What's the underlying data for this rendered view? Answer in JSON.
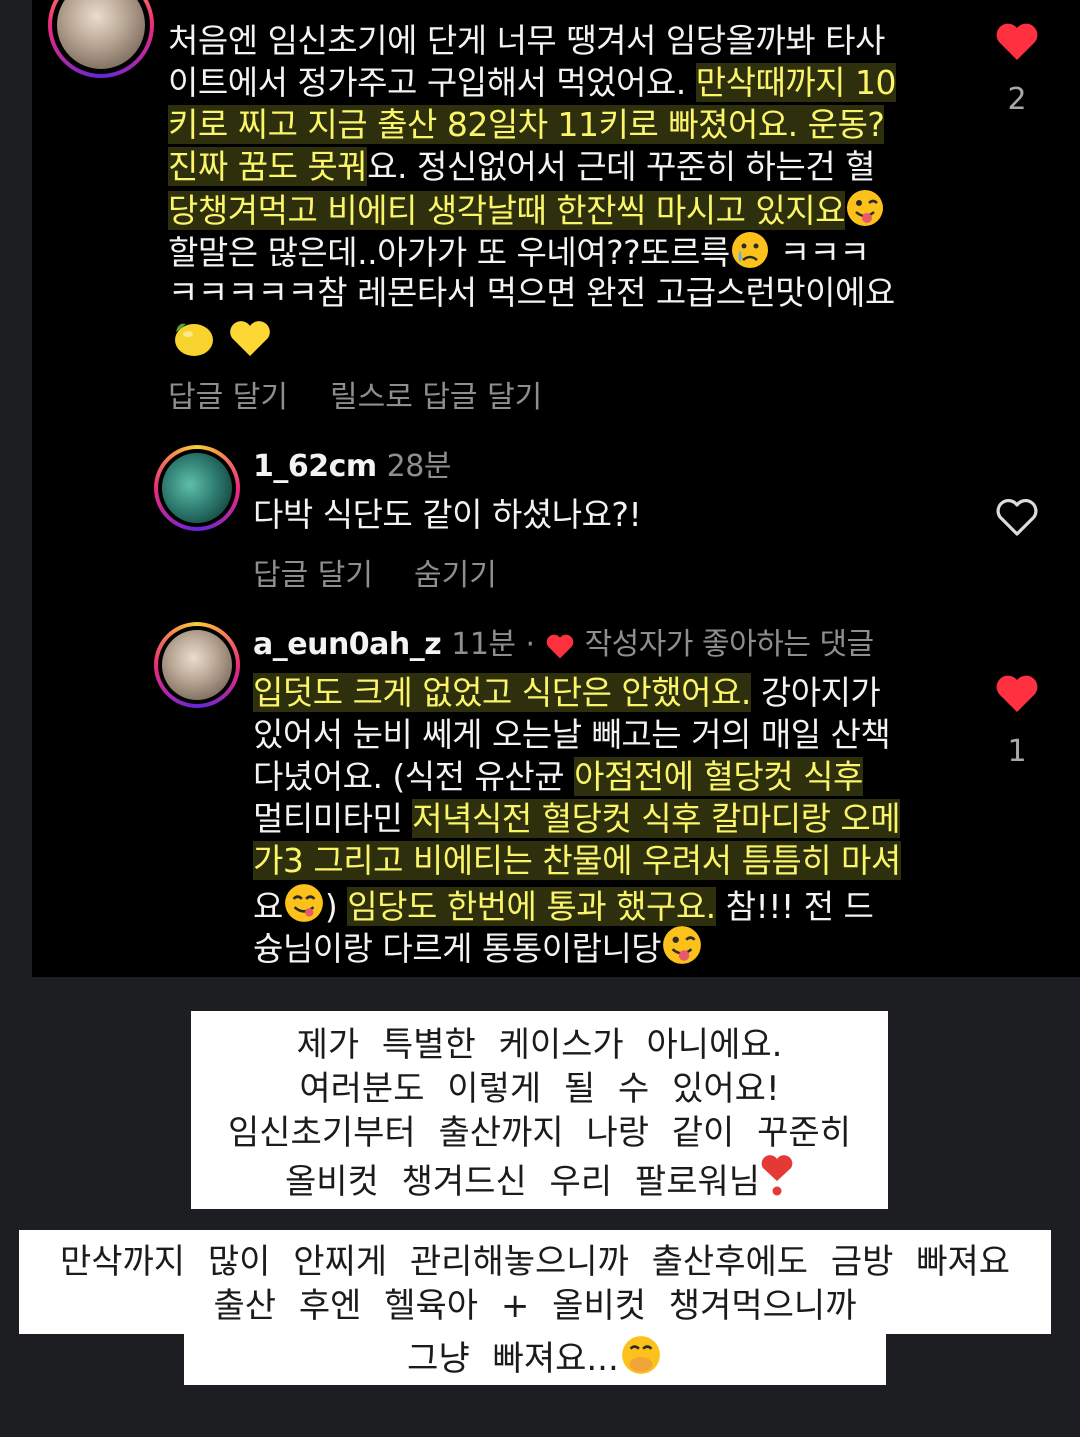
{
  "colors": {
    "background": "#1d1e21",
    "panel": "#000000",
    "highlight_text": "#fbf56a",
    "muted": "#8e8e8e",
    "like_red": "#ff3040"
  },
  "comment1": {
    "line1": "처음엔 임신초기에 단게 너무 땡겨서 임당올까봐 타사",
    "line2a": "이트에서 정가주고 구입해서 먹었어요. ",
    "line2b": "만삭때까지 10",
    "line3": "키로 찌고 지금 출산 82일차 11키로 빠졌어요. 운동?",
    "line4a": "진짜 꿈도 못꿔",
    "line4b": "요. 정신없어서 근데 꾸준히 하는건 혈",
    "line5": "당챙겨먹고 비에티 생각날때 한잔씩 마시고 있지요",
    "line6a": "할말은 많은데..아가가 또 우네여??또르륵",
    "line6b": " ㅋㅋㅋ",
    "line7": "ㅋㅋㅋㅋㅋ참 레몬타서 먹으면 완전 고급스런맛이에요",
    "like_count": "2",
    "reply_action": "답글 달기",
    "reels_reply_action": "릴스로 답글 달기"
  },
  "comment2": {
    "username": "1_62cm",
    "time": "28분",
    "text": "다박 식단도 같이 하셨나요?!",
    "reply_action": "답글 달기",
    "hide_action": "숨기기"
  },
  "comment3": {
    "username": "a_eun0ah_z",
    "time": "11분",
    "separator": "·",
    "liked_by_author": "작성자가 좋아하는 댓글",
    "line1a": "입덧도 크게 없었고 식단은 안했어요.",
    "line1b": " 강아지가",
    "line2": "있어서 눈비 쎄게 오는날 빼고는 거의 매일 산책",
    "line3a": "다녔어요. (식전 유산균 ",
    "line3b": "아점전에 혈당컷 식후",
    "line4a": "멀티미타민 ",
    "line4b": "저녁식전 혈당컷 식후 칼마디랑 오메",
    "line5": "가3 그리고 비에티는 찬물에 우려서 틈틈히 마셔",
    "line6a": "요",
    "line6b": ") ",
    "line6c": "임당도 한번에 통과 했구요.",
    "line6d": " 참!!! 전 드",
    "line7": "슝님이랑 다르게 통통이랍니당",
    "like_count": "1"
  },
  "caption1": {
    "line1": "제가 특별한 케이스가 아니에요.",
    "line2": "여러분도 이렇게 될 수 있어요!",
    "line3": "임신초기부터 출산까지 나랑 같이 꾸준히",
    "line4": "올비컷 챙겨드신 우리 팔로워님"
  },
  "caption2": {
    "line1": "만삭까지 많이 안찌게 관리해놓으니까 출산후에도 금방 빠져요",
    "line2": "출산 후엔 헬육아 + 올비컷 챙겨먹으니까",
    "line3": "그냥 빠져요..."
  },
  "icons": [
    "heart-filled-icon",
    "heart-outline-icon",
    "lemon-emoji",
    "yellow-heart-emoji",
    "wink-tongue-emoji",
    "crying-emoji",
    "yum-emoji",
    "heart-exclamation-emoji",
    "hand-over-mouth-emoji"
  ]
}
